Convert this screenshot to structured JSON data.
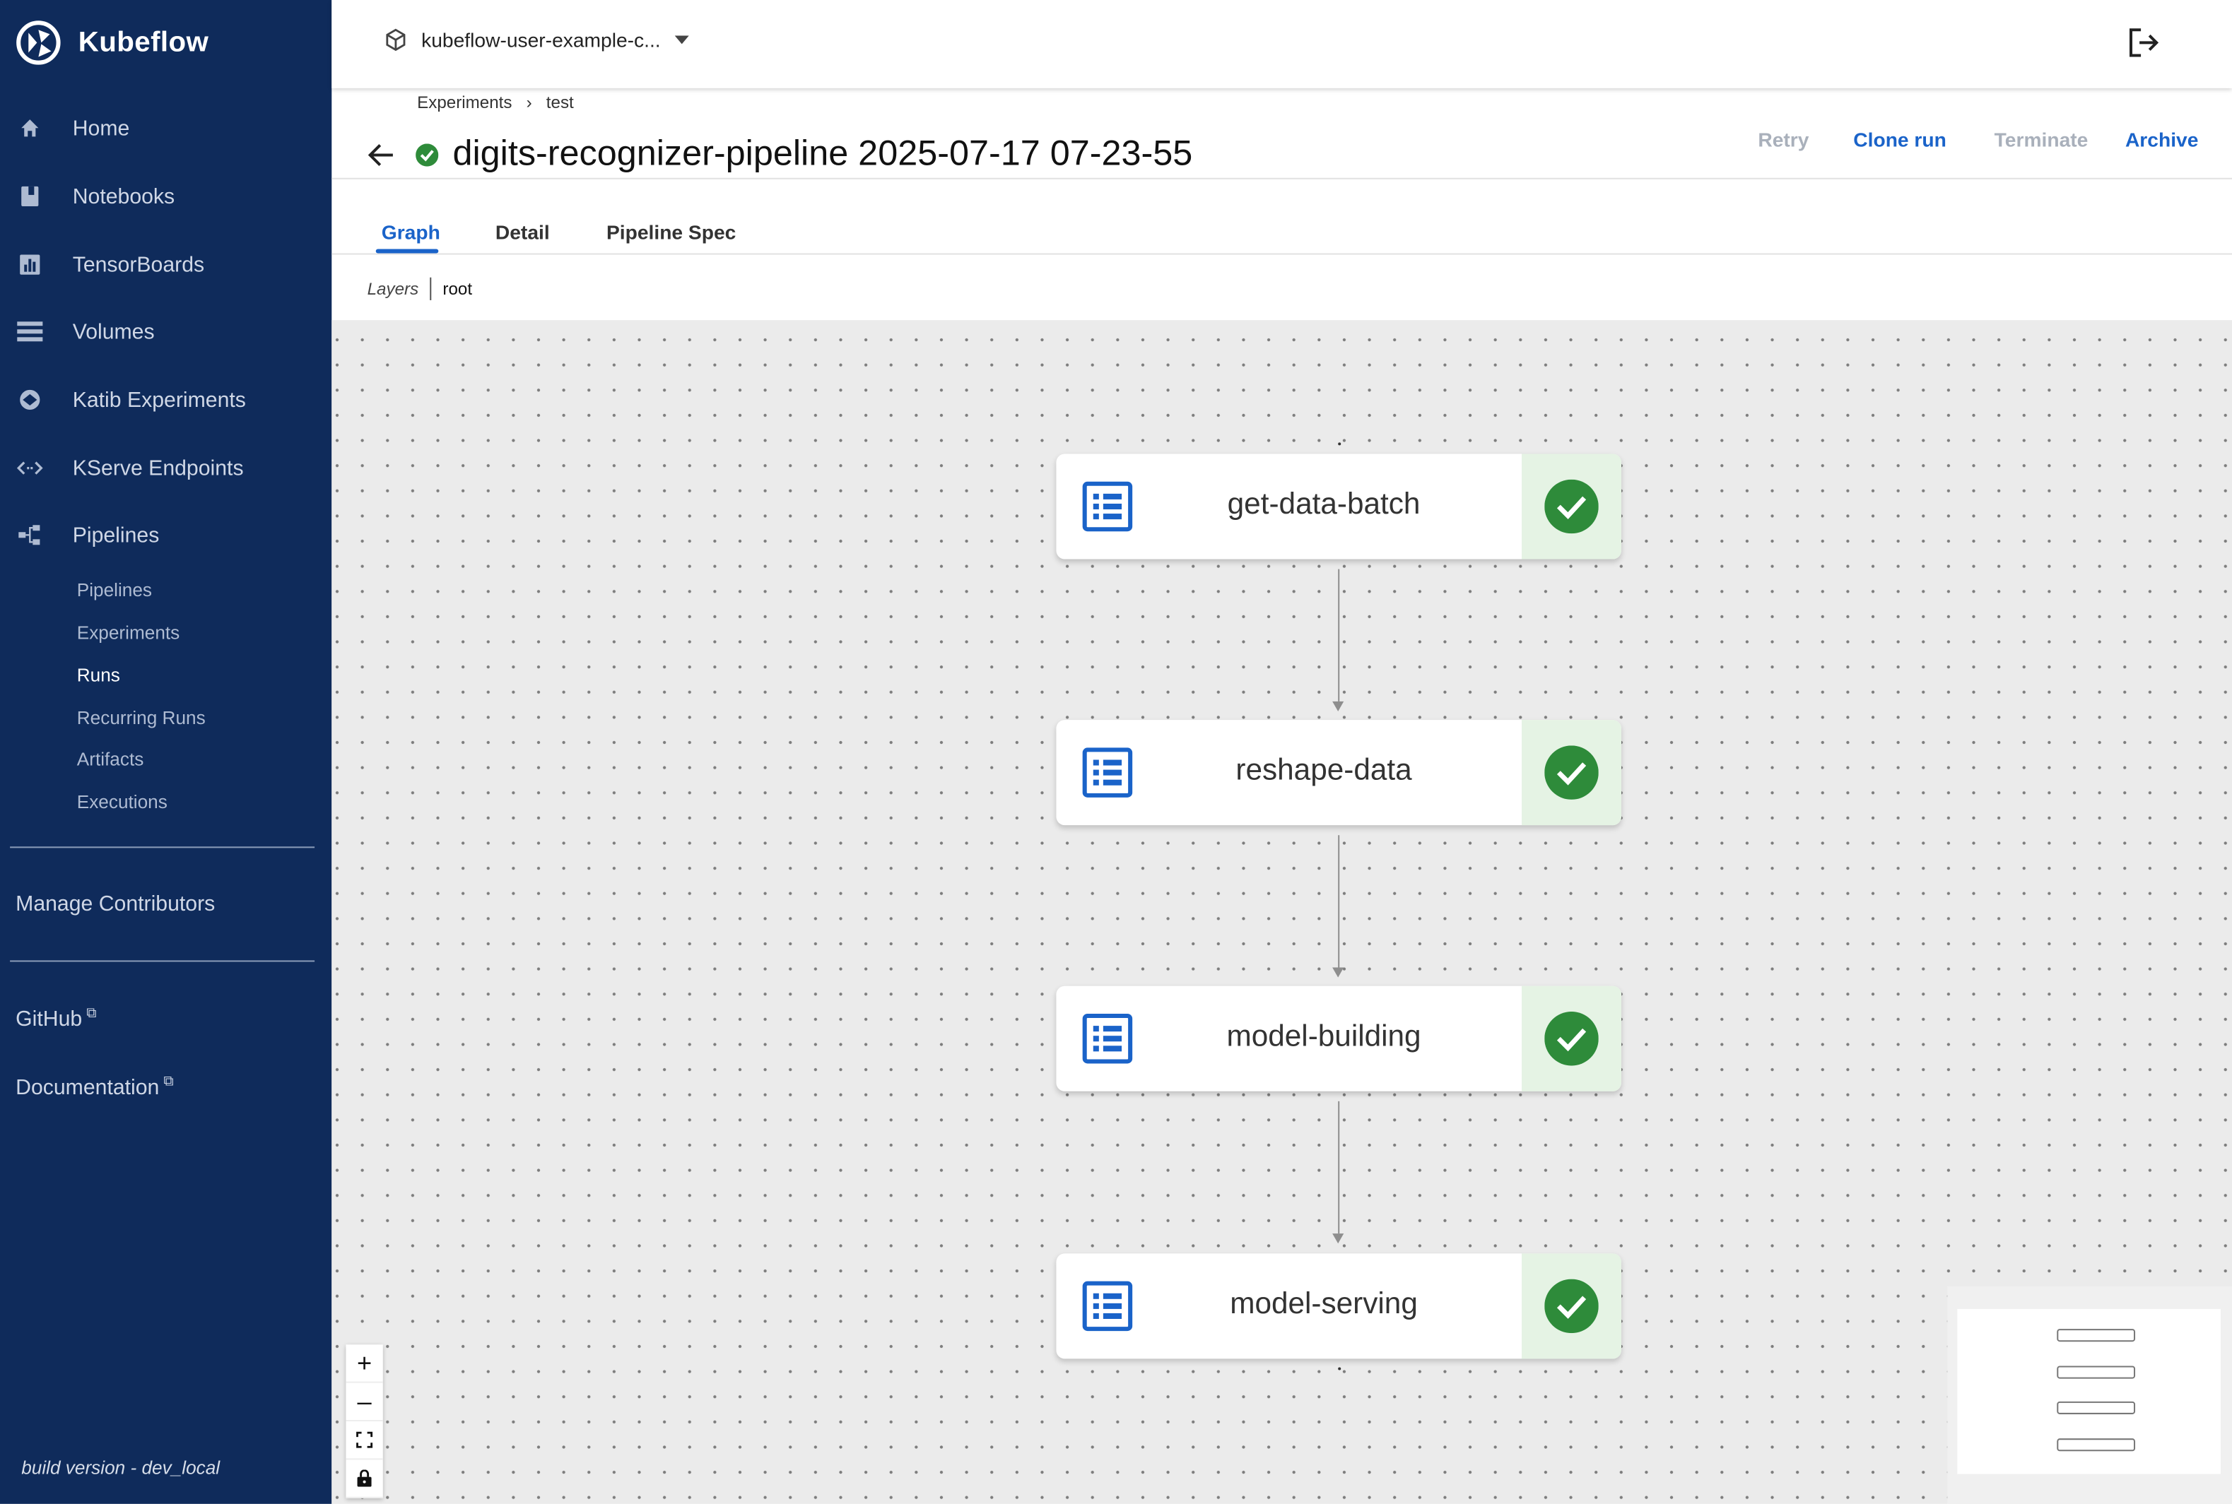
{
  "sidebar": {
    "brand": "Kubeflow",
    "nav": [
      {
        "label": "Home",
        "icon": "home-icon"
      },
      {
        "label": "Notebooks",
        "icon": "book-icon"
      },
      {
        "label": "TensorBoards",
        "icon": "bar-chart-icon"
      },
      {
        "label": "Volumes",
        "icon": "storage-icon"
      },
      {
        "label": "Katib Experiments",
        "icon": "katib-icon"
      },
      {
        "label": "KServe Endpoints",
        "icon": "code-arrows-icon"
      },
      {
        "label": "Pipelines",
        "icon": "pipeline-icon"
      }
    ],
    "pipelines_sub": [
      "Pipelines",
      "Experiments",
      "Runs",
      "Recurring Runs",
      "Artifacts",
      "Executions"
    ],
    "active_sub": "Runs",
    "manage": "Manage Contributors",
    "github": "GitHub",
    "docs": "Documentation",
    "build": "build version - dev_local"
  },
  "topbar": {
    "namespace": "kubeflow-user-example-c..."
  },
  "header": {
    "breadcrumb": [
      "Experiments",
      "test"
    ],
    "breadcrumb_sep": "›",
    "title": "digits-recognizer-pipeline 2025-07-17 07-23-55",
    "actions": [
      {
        "label": "Retry",
        "enabled": false
      },
      {
        "label": "Clone run",
        "enabled": true
      },
      {
        "label": "Terminate",
        "enabled": false
      },
      {
        "label": "Archive",
        "enabled": true
      }
    ]
  },
  "tabs": [
    "Graph",
    "Detail",
    "Pipeline Spec"
  ],
  "active_tab": "Graph",
  "layers": {
    "label": "Layers",
    "current": "root"
  },
  "graph": {
    "nodes": [
      {
        "label": "get-data-batch",
        "status": "succeeded"
      },
      {
        "label": "reshape-data",
        "status": "succeeded"
      },
      {
        "label": "model-building",
        "status": "succeeded"
      },
      {
        "label": "model-serving",
        "status": "succeeded"
      }
    ]
  },
  "zoom_controls": [
    "+",
    "–"
  ],
  "colors": {
    "sidebar": "#0f2b5b",
    "accent": "#1a63c9",
    "success": "#2e8b3a",
    "canvas": "#ebebeb"
  }
}
